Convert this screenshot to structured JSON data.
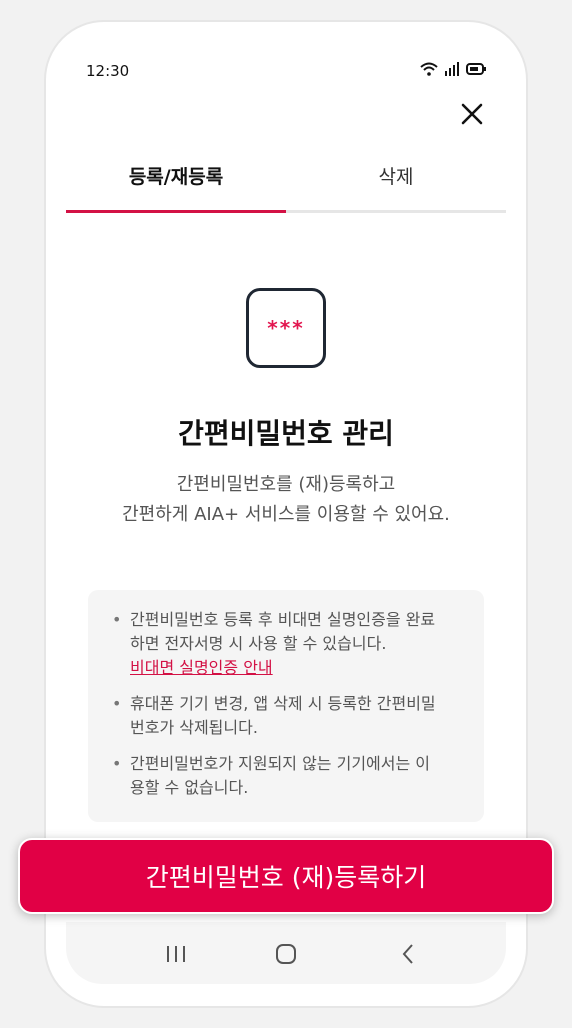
{
  "status_bar": {
    "time": "12:30"
  },
  "tabs": [
    {
      "label": "등록/재등록",
      "active": true
    },
    {
      "label": "삭제",
      "active": false
    }
  ],
  "icon": {
    "stars": "***",
    "accent": "#e2164f"
  },
  "main": {
    "title": "간편비밀번호 관리",
    "desc_line1": "간편비밀번호를 (재)등록하고",
    "desc_line2": "간편하게 AIA+ 서비스를 이용할 수 있어요."
  },
  "info": {
    "item1_line1": "간편비밀번호 등록 후 비대면 실명인증을 완료",
    "item1_line2": "하면 전자서명 시 사용 할 수 있습니다.",
    "item1_link": "비대면 실명인증 안내",
    "item2_line1": "휴대폰 기기 변경, 앱 삭제 시 등록한 간편비밀",
    "item2_line2": "번호가 삭제됩니다.",
    "item3_line1": "간편비밀번호가 지원되지 않는 기기에서는 이",
    "item3_line2": "용할 수 없습니다."
  },
  "cta": {
    "label": "간편비밀번호 (재)등록하기",
    "color": "#e10045"
  }
}
